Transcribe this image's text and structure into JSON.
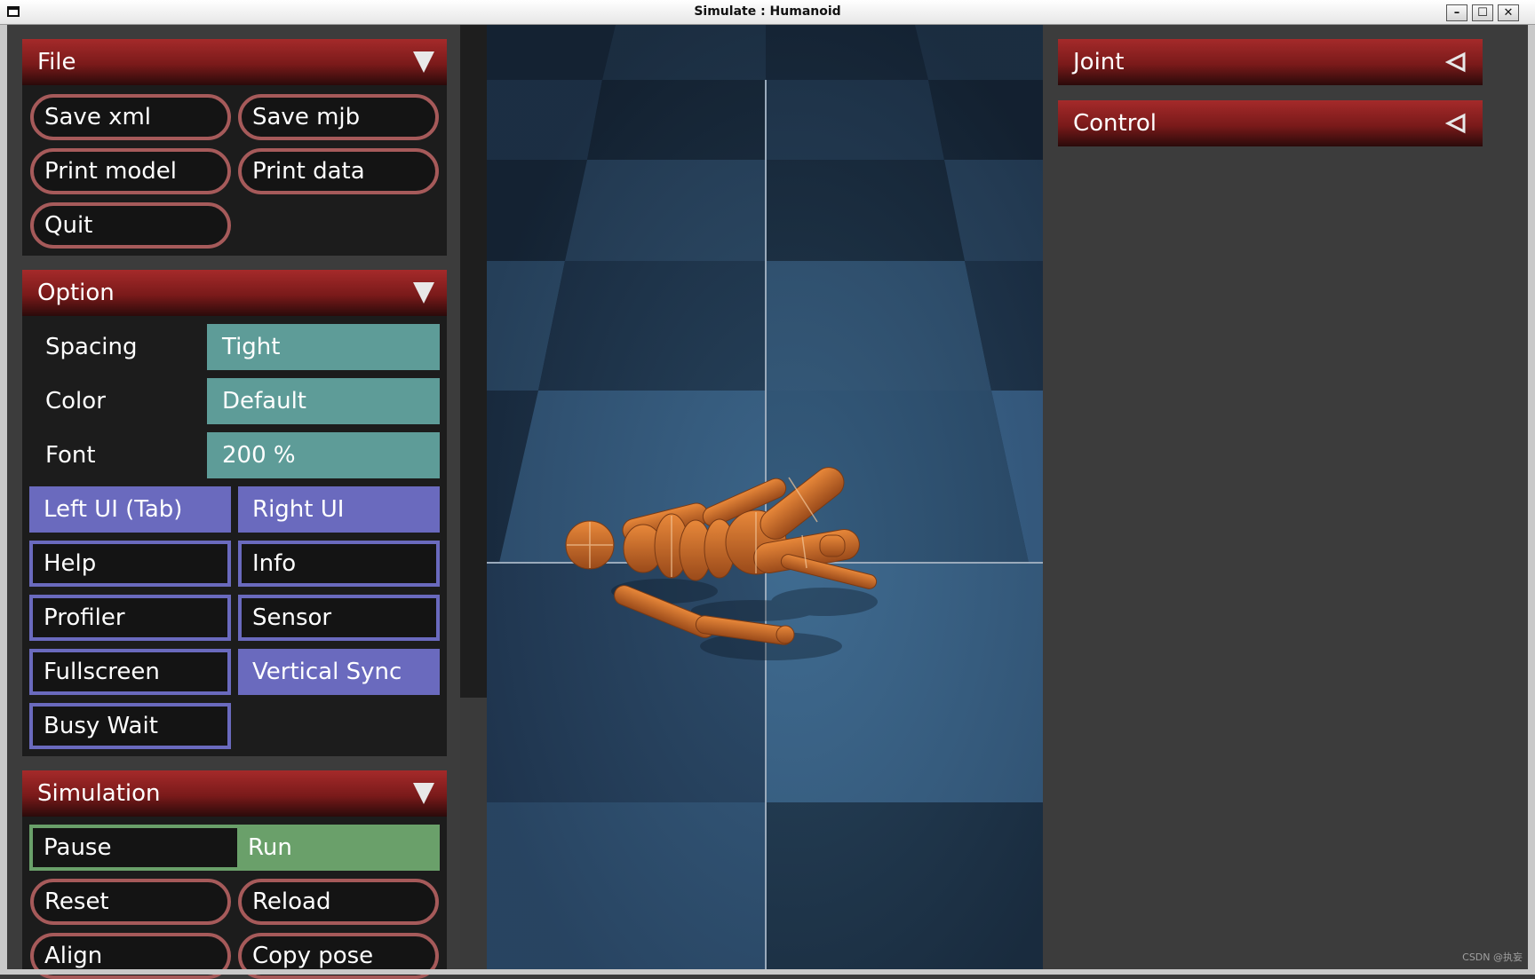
{
  "window": {
    "title": "Simulate : Humanoid",
    "minimize_label": "–",
    "maximize_label": "☐",
    "close_label": "✕"
  },
  "left_panel": {
    "file": {
      "title": "File",
      "buttons": [
        "Save xml",
        "Save mjb",
        "Print model",
        "Print data",
        "Quit"
      ]
    },
    "option": {
      "title": "Option",
      "spacing_label": "Spacing",
      "spacing_value": "Tight",
      "color_label": "Color",
      "color_value": "Default",
      "font_label": "Font",
      "font_value": "200 %",
      "toggles": [
        {
          "label": "Left UI (Tab)",
          "checked": true
        },
        {
          "label": "Right UI",
          "checked": true
        },
        {
          "label": "Help",
          "checked": false
        },
        {
          "label": "Info",
          "checked": false
        },
        {
          "label": "Profiler",
          "checked": false
        },
        {
          "label": "Sensor",
          "checked": false
        },
        {
          "label": "Fullscreen",
          "checked": false
        },
        {
          "label": "Vertical Sync",
          "checked": true
        },
        {
          "label": "Busy Wait",
          "checked": false
        }
      ]
    },
    "simulation": {
      "title": "Simulation",
      "mode_options": [
        "Pause",
        "Run"
      ],
      "mode_selected": "Run",
      "buttons": [
        "Reset",
        "Reload",
        "Align",
        "Copy pose"
      ]
    }
  },
  "right_panel": {
    "sections": [
      {
        "title": "Joint",
        "collapsed": true
      },
      {
        "title": "Control",
        "collapsed": true
      }
    ]
  },
  "colors": {
    "section_header": "#a52a2a",
    "button_border": "#a65a5a",
    "checkbox_accent": "#6a6abe",
    "select_bg": "#5e9c98",
    "radio_accent": "#6aa06a",
    "model_body": "#c8682a"
  },
  "watermark": "CSDN @执妄"
}
